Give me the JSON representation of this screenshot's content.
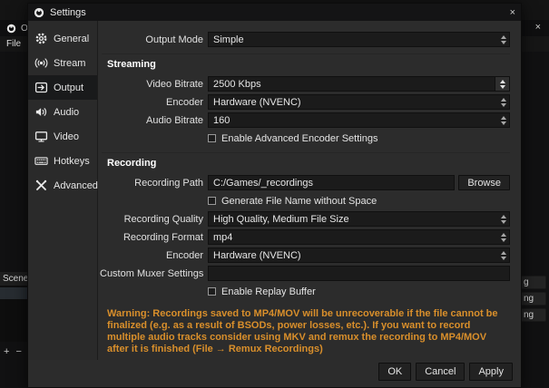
{
  "background": {
    "titlebar_fragment": "O",
    "close": "×",
    "menu": {
      "file": "File"
    },
    "scenes": {
      "header": "Scene",
      "add": "+",
      "remove": "−"
    },
    "right_fragments": [
      "g",
      "ng",
      "ng"
    ]
  },
  "dialog": {
    "title": "Settings",
    "close": "×",
    "sidebar": [
      {
        "label": "General"
      },
      {
        "label": "Stream"
      },
      {
        "label": "Output"
      },
      {
        "label": "Audio"
      },
      {
        "label": "Video"
      },
      {
        "label": "Hotkeys"
      },
      {
        "label": "Advanced"
      }
    ],
    "output_mode": {
      "label": "Output Mode",
      "value": "Simple"
    },
    "streaming": {
      "header": "Streaming",
      "video_bitrate": {
        "label": "Video Bitrate",
        "value": "2500 Kbps"
      },
      "encoder": {
        "label": "Encoder",
        "value": "Hardware (NVENC)"
      },
      "audio_bitrate": {
        "label": "Audio Bitrate",
        "value": "160"
      },
      "advanced_encoder_checkbox": {
        "label": "Enable Advanced Encoder Settings",
        "checked": false
      }
    },
    "recording": {
      "header": "Recording",
      "recording_path": {
        "label": "Recording Path",
        "value": "C:/Games/_recordings"
      },
      "browse_button": "Browse",
      "generate_filename_checkbox": {
        "label": "Generate File Name without Space",
        "checked": false
      },
      "recording_quality": {
        "label": "Recording Quality",
        "value": "High Quality, Medium File Size"
      },
      "recording_format": {
        "label": "Recording Format",
        "value": "mp4"
      },
      "encoder": {
        "label": "Encoder",
        "value": "Hardware (NVENC)"
      },
      "custom_muxer": {
        "label": "Custom Muxer Settings",
        "value": ""
      },
      "replay_buffer_checkbox": {
        "label": "Enable Replay Buffer",
        "checked": false
      }
    },
    "warning": "Warning: Recordings saved to MP4/MOV will be unrecoverable if the file cannot be finalized (e.g. as a result of BSODs, power losses, etc.). If you want to record multiple audio tracks consider using MKV and remux the recording to MP4/MOV after it is finished (File → Remux Recordings)",
    "footer": {
      "ok": "OK",
      "cancel": "Cancel",
      "apply": "Apply"
    }
  },
  "colors": {
    "dialog_bg": "#2c2c2c",
    "input_bg": "#1b1b1b",
    "selected_sidebar_bg": "#191a1b",
    "warning_text": "#d98f2b"
  }
}
